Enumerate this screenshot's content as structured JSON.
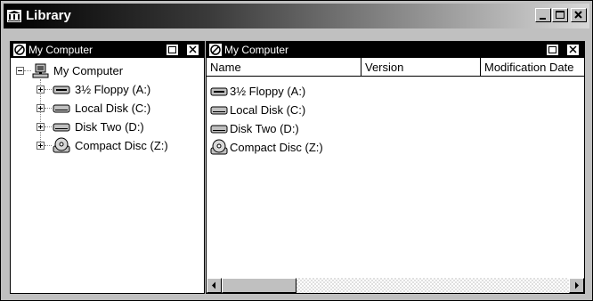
{
  "window": {
    "title": "Library"
  },
  "left_pane": {
    "title": "My Computer",
    "tree": {
      "root": "My Computer",
      "items": [
        {
          "label": "3½ Floppy (A:)",
          "icon": "floppy-drive-icon"
        },
        {
          "label": "Local Disk (C:)",
          "icon": "hard-disk-icon"
        },
        {
          "label": "Disk Two (D:)",
          "icon": "hard-disk-icon"
        },
        {
          "label": "Compact Disc (Z:)",
          "icon": "cd-drive-icon"
        }
      ]
    }
  },
  "right_pane": {
    "title": "My Computer",
    "columns": [
      "Name",
      "Version",
      "Modification Date"
    ],
    "rows": [
      {
        "name": "3½ Floppy (A:)",
        "icon": "floppy-drive-icon"
      },
      {
        "name": "Local Disk (C:)",
        "icon": "hard-disk-icon"
      },
      {
        "name": "Disk Two (D:)",
        "icon": "hard-disk-icon"
      },
      {
        "name": "Compact Disc (Z:)",
        "icon": "cd-drive-icon"
      }
    ]
  }
}
